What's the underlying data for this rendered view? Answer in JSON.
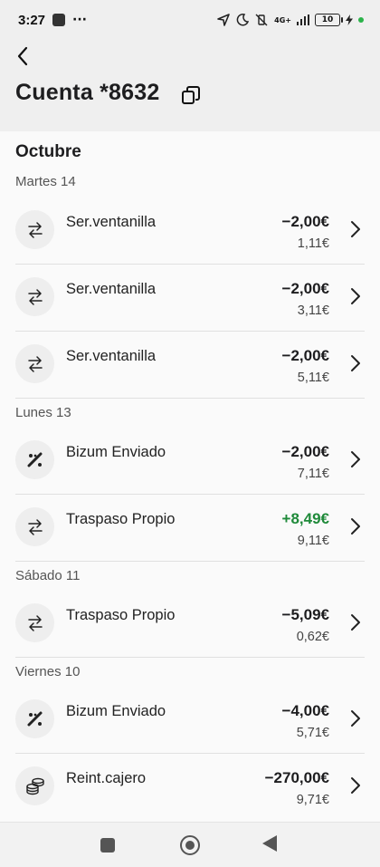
{
  "status": {
    "time": "3:27",
    "dots": "···",
    "network": "4G+",
    "battery": "10"
  },
  "header": {
    "title": "Cuenta *8632"
  },
  "month": "Octubre",
  "days": [
    "Martes 14",
    "Lunes 13",
    "Sábado 11",
    "Viernes 10"
  ],
  "transactions": [
    {
      "name": "Ser.ventanilla",
      "amount": "−2,00€",
      "balance": "1,11€",
      "icon": "transfer-icon"
    },
    {
      "name": "Ser.ventanilla",
      "amount": "−2,00€",
      "balance": "3,11€",
      "icon": "transfer-icon"
    },
    {
      "name": "Ser.ventanilla",
      "amount": "−2,00€",
      "balance": "5,11€",
      "icon": "transfer-icon"
    },
    {
      "name": "Bizum Enviado",
      "amount": "−2,00€",
      "balance": "7,11€",
      "icon": "bizum-icon"
    },
    {
      "name": "Traspaso Propio",
      "amount": "+8,49€",
      "balance": "9,11€",
      "icon": "transfer-icon"
    },
    {
      "name": "Traspaso Propio",
      "amount": "−5,09€",
      "balance": "0,62€",
      "icon": "transfer-icon"
    },
    {
      "name": "Bizum Enviado",
      "amount": "−4,00€",
      "balance": "5,71€",
      "icon": "bizum-icon"
    },
    {
      "name": "Reint.cajero",
      "amount": "−270,00€",
      "balance": "9,71€",
      "icon": "coins-icon"
    }
  ],
  "colors": {
    "positive": "#1f8a3a",
    "header_bg": "#efefef"
  }
}
